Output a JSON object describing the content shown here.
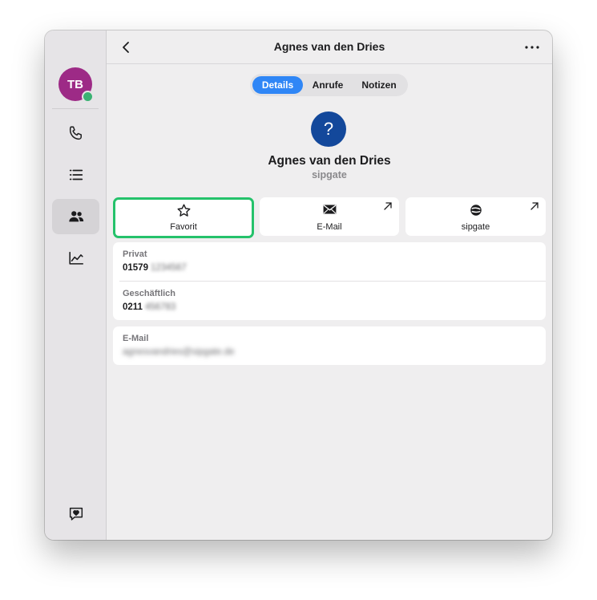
{
  "window": {
    "title": "Agnes van den Dries"
  },
  "sidebar": {
    "avatar_initials": "TB",
    "items": [
      {
        "name": "phone",
        "icon": "phone-icon",
        "active": false
      },
      {
        "name": "list",
        "icon": "list-icon",
        "active": false
      },
      {
        "name": "contacts",
        "icon": "contacts-icon",
        "active": true
      },
      {
        "name": "statistics",
        "icon": "chart-icon",
        "active": false
      }
    ],
    "bottom_icon": "feedback-heart-icon"
  },
  "tabs": [
    {
      "label": "Details",
      "active": true
    },
    {
      "label": "Anrufe",
      "active": false
    },
    {
      "label": "Notizen",
      "active": false
    }
  ],
  "contact": {
    "avatar_glyph": "?",
    "name": "Agnes van den Dries",
    "company": "sipgate"
  },
  "actions": {
    "favorit": "Favorit",
    "email": "E-Mail",
    "sipgate": "sipgate"
  },
  "phones": [
    {
      "label": "Privat",
      "value": "01579",
      "hidden": "1234567"
    },
    {
      "label": "Geschäftlich",
      "value": "0211",
      "hidden": "456783"
    }
  ],
  "email": {
    "label": "E-Mail",
    "value": "agnesvandries@sipgate.de"
  },
  "colors": {
    "accent": "#2f86f6",
    "favorite_highlight": "#25c26b",
    "user_avatar": "#9d2a86",
    "contact_avatar": "#13489b",
    "presence": "#3bb273"
  }
}
